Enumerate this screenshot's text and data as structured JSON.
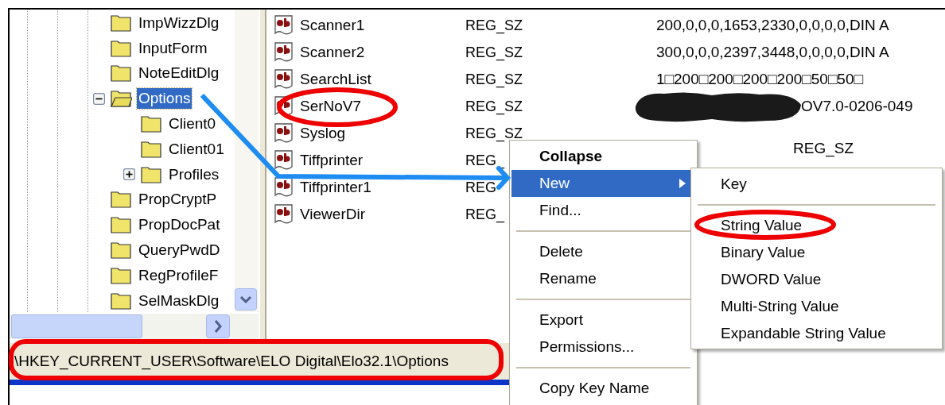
{
  "tree": {
    "items": [
      {
        "label": "ImpWizzDlg",
        "selected": false
      },
      {
        "label": "InputForm",
        "selected": false
      },
      {
        "label": "NoteEditDlg",
        "selected": false
      },
      {
        "label": "Options",
        "selected": true,
        "expanded": true,
        "children": [
          {
            "label": "Client0",
            "selected": false
          },
          {
            "label": "Client01",
            "selected": false
          },
          {
            "label": "Profiles",
            "selected": false,
            "expanded": false
          }
        ]
      },
      {
        "label": "PropCryptP",
        "selected": false
      },
      {
        "label": "PropDocPat",
        "selected": false
      },
      {
        "label": "QueryPwdD",
        "selected": false
      },
      {
        "label": "RegProfileF",
        "selected": false
      },
      {
        "label": "SelMaskDlg",
        "selected": false
      }
    ]
  },
  "values": {
    "rows": [
      {
        "name": "Scanner1",
        "type": "REG_SZ",
        "data": "200,0,0,0,1653,2330,0,0,0,0,DIN A"
      },
      {
        "name": "Scanner2",
        "type": "REG_SZ",
        "data": "300,0,0,0,2397,3448,0,0,0,0,DIN A"
      },
      {
        "name": "SearchList",
        "type": "REG_SZ",
        "data": "1□200□200□200□200□50□50□"
      },
      {
        "name": "SerNoV7",
        "type": "REG_SZ",
        "data": "OV7.0-0206-049",
        "redacted": true
      },
      {
        "name": "Syslog",
        "type": "REG_SZ"
      },
      {
        "name": "Tiffprinter",
        "type": "REG_"
      },
      {
        "name": "Tiffprinter1",
        "type": "REG"
      },
      {
        "name": "ViewerDir",
        "type": "REG_"
      }
    ]
  },
  "stray_text": "REG_SZ",
  "context_menu": {
    "items": [
      {
        "kind": "item",
        "label": "Collapse",
        "bold": true,
        "selected": false
      },
      {
        "kind": "submenu",
        "label": "New",
        "selected": true
      },
      {
        "kind": "item",
        "label": "Find...",
        "selected": false
      },
      {
        "kind": "separator"
      },
      {
        "kind": "item",
        "label": "Delete",
        "selected": false
      },
      {
        "kind": "item",
        "label": "Rename",
        "selected": false
      },
      {
        "kind": "separator"
      },
      {
        "kind": "item",
        "label": "Export",
        "selected": false
      },
      {
        "kind": "item",
        "label": "Permissions...",
        "selected": false
      },
      {
        "kind": "separator"
      },
      {
        "kind": "item",
        "label": "Copy Key Name",
        "selected": false
      }
    ]
  },
  "submenu": {
    "items": [
      {
        "kind": "item",
        "label": "Key",
        "selected": false
      },
      {
        "kind": "separator"
      },
      {
        "kind": "item",
        "label": "String Value",
        "selected": false
      },
      {
        "kind": "item",
        "label": "Binary Value",
        "selected": false
      },
      {
        "kind": "item",
        "label": "DWORD Value",
        "selected": false
      },
      {
        "kind": "item",
        "label": "Multi-String Value",
        "selected": false
      },
      {
        "kind": "item",
        "label": "Expandable String Value",
        "selected": false
      }
    ]
  },
  "status_bar": {
    "path": "\\HKEY_CURRENT_USER\\Software\\ELO Digital\\Elo32.1\\Options"
  }
}
